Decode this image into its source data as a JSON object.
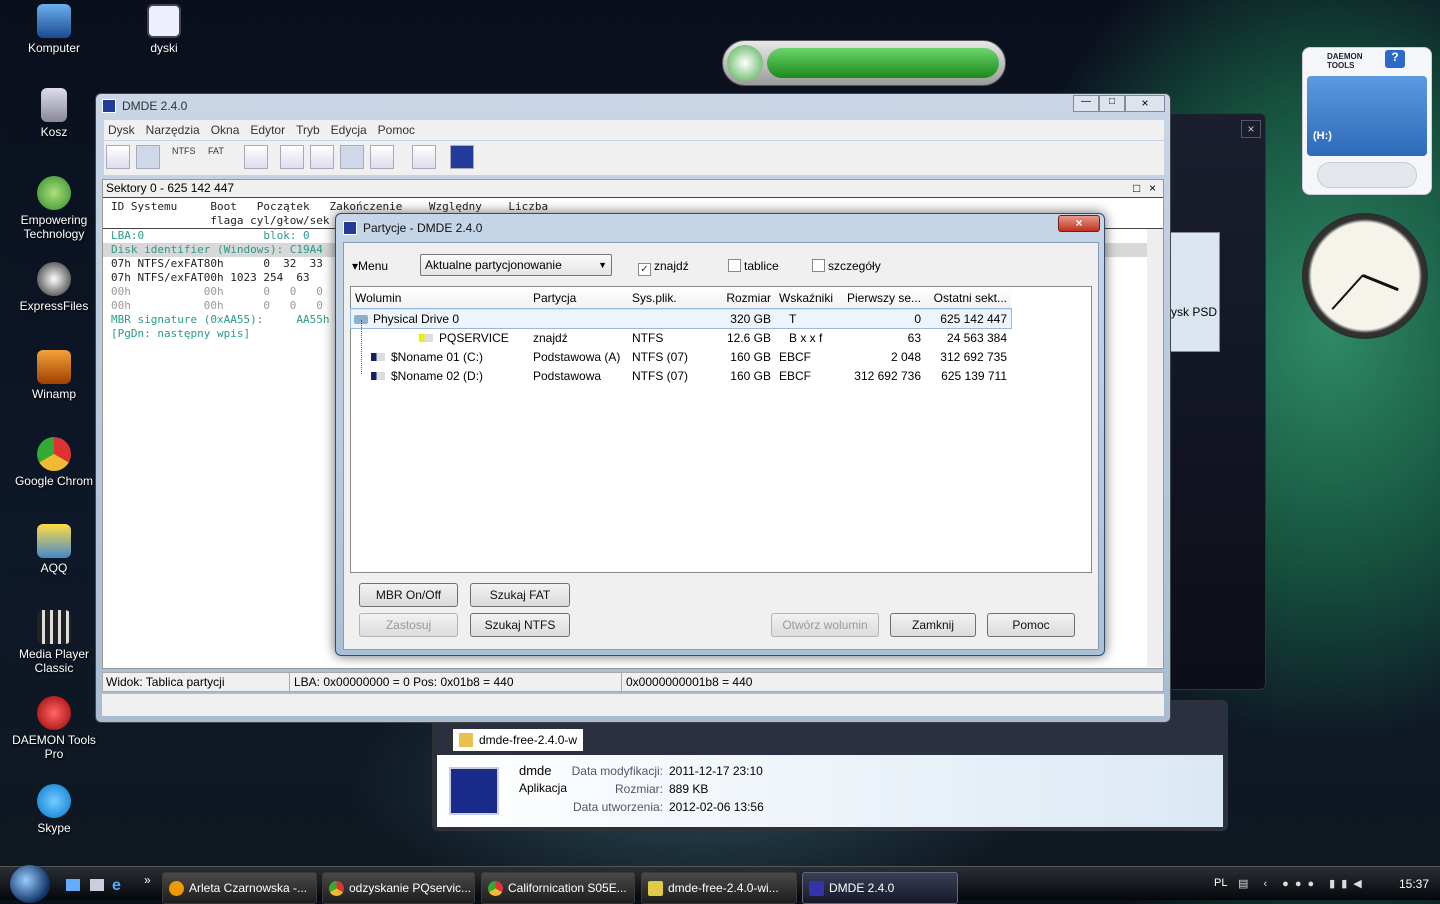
{
  "desktop": {
    "icons": [
      {
        "label": "Komputer"
      },
      {
        "label": "dyski"
      },
      {
        "label": "Kosz"
      },
      {
        "label": "Empowering Technology"
      },
      {
        "label": "ExpressFiles"
      },
      {
        "label": "Winamp"
      },
      {
        "label": "Google Chrom"
      },
      {
        "label": "AQQ"
      },
      {
        "label": "Media Player Classic"
      },
      {
        "label": "DAEMON Tools Pro"
      },
      {
        "label": "Skype"
      }
    ]
  },
  "daemon_gadget": {
    "brand": "DAEMON TOOLS",
    "drive": "(H:)"
  },
  "explorer": {
    "file_row": "dmde-free-2.4.0-w",
    "details": {
      "name": "dmde",
      "type": "Aplikacja",
      "modified_label": "Data modyfikacji:",
      "modified": "2011-12-17 23:10",
      "size_label": "Rozmiar:",
      "size": "889 KB",
      "created_label": "Data utworzenia:",
      "created": "2012-02-06 13:56"
    },
    "side_text": "ysk PSD"
  },
  "dmde": {
    "title": "DMDE 2.4.0",
    "menu": [
      "Dysk",
      "Narzędzia",
      "Okna",
      "Edytor",
      "Tryb",
      "Edycja",
      "Pomoc"
    ],
    "toolbar": {
      "ntfs": "NTFS",
      "fat": "FAT"
    },
    "panel_title": "Sektory 0 - 625 142 447",
    "headers1": "ID Systemu     Boot   Początek   Zakończenie    Względny    Liczba",
    "headers2": "               flaga cyl/głow/sek",
    "lines": [
      {
        "text": "LBA:0                  blok: 0",
        "color": "#2a9a8a"
      },
      {
        "text": "Disk identifier (Windows): C19A4",
        "color": "#2a9a8a",
        "hl": true
      },
      {
        "text": "07h NTFS/exFAT80h      0  32  33",
        "color": "#222"
      },
      {
        "text": "07h NTFS/exFAT00h 1023 254  63",
        "color": "#222"
      },
      {
        "text": "00h           00h      0   0   0",
        "color": "#999"
      },
      {
        "text": "00h           00h      0   0   0",
        "color": "#999"
      },
      {
        "text": "MBR signature (0xAA55):     AA55h",
        "color": "#2a9a8a"
      },
      {
        "text": "[PgDn: następny wpis]",
        "color": "#2a9a8a"
      }
    ],
    "status": {
      "view": "Widok: Tablica partycji",
      "lba": "LBA: 0x00000000 = 0  Pos: 0x01b8 = 440",
      "offset": "0x0000000001b8 = 440"
    }
  },
  "dialog": {
    "title": "Partycje - DMDE 2.4.0",
    "menu": "Menu",
    "mode": "Aktualne partycjonowanie",
    "checks": [
      {
        "label": "znajdź",
        "checked": true
      },
      {
        "label": "tablice",
        "checked": false
      },
      {
        "label": "szczegóły",
        "checked": false
      }
    ],
    "columns": [
      "Wolumin",
      "Partycja",
      "Sys.plik.",
      "Rozmiar",
      "Wskaźniki",
      "Pierwszy se...",
      "Ostatni sekt..."
    ],
    "rows": [
      {
        "name": "Physical Drive 0",
        "part": "",
        "fs": "",
        "size": "320 GB",
        "flags": "T",
        "first": "0",
        "last": "625 142 447"
      },
      {
        "name": "PQSERVICE",
        "part": "znajdź",
        "fs": "NTFS",
        "size": "12.6 GB",
        "flags": "B x x f",
        "first": "63",
        "last": "24 563 384"
      },
      {
        "name": "$Noname 01 (C:)",
        "part": "Podstawowa (A)",
        "fs": "NTFS (07)",
        "size": "160 GB",
        "flags": "EBCF",
        "first": "2 048",
        "last": "312 692 735"
      },
      {
        "name": "$Noname 02 (D:)",
        "part": "Podstawowa",
        "fs": "NTFS (07)",
        "size": "160 GB",
        "flags": "EBCF",
        "first": "312 692 736",
        "last": "625 139 711"
      }
    ],
    "buttons": {
      "mbr": "MBR On/Off",
      "fat": "Szukaj FAT",
      "apply": "Zastosuj",
      "ntfs": "Szukaj NTFS",
      "open": "Otwórz wolumin",
      "close": "Zamknij",
      "help": "Pomoc"
    }
  },
  "taskbar": {
    "items": [
      "Arleta Czarnowska -...",
      "odzyskanie PQservic...",
      "Californication S05E...",
      "dmde-free-2.4.0-wi...",
      "DMDE 2.4.0"
    ],
    "lang": "PL",
    "clock": "15:37"
  }
}
